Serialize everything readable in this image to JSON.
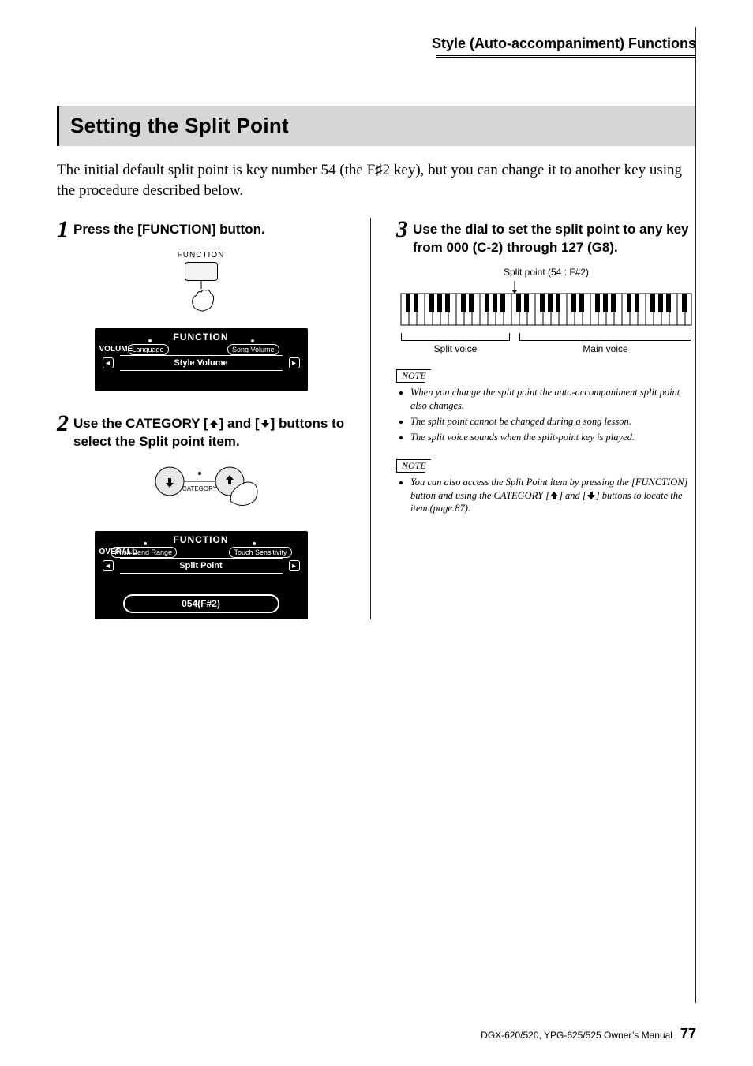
{
  "header": {
    "chapter": "Style (Auto-accompaniment) Functions"
  },
  "section_title": "Setting the Split Point",
  "intro_pre": "The initial default split point is key number 54 (the F",
  "intro_sharp": "♯",
  "intro_post": "2 key), but you can change it to another key using the procedure described below.",
  "steps": {
    "s1": {
      "num": "1",
      "text": "Press the [FUNCTION] button."
    },
    "s2": {
      "num": "2",
      "pre": "Use the CATEGORY [",
      "mid": "] and [",
      "post": "] buttons to select the Split point item."
    },
    "s3": {
      "num": "3",
      "text": "Use the dial to set the split point to any key from 000 (C-2) through 127 (G8)."
    }
  },
  "fig1": {
    "btn_label": "FUNCTION",
    "lcd_title": "FUNCTION",
    "lcd_tag": "VOLUME",
    "left_pill": "Language",
    "right_pill": "Song Volume",
    "center": "Style Volume",
    "arrow_l": "◂",
    "arrow_r": "▸"
  },
  "fig2": {
    "cat_label": "CATEGORY",
    "lcd_title": "FUNCTION",
    "lcd_tag": "OVERALL",
    "left_pill": "Pitch Bend Range",
    "right_pill": "Touch Sensitivity",
    "center": "Split Point",
    "value": "054(F#2)",
    "arrow_l": "◂",
    "arrow_r": "▸"
  },
  "kb": {
    "caption": "Split point (54 : F#2)",
    "split_label": "Split voice",
    "main_label": "Main voice"
  },
  "notes1": {
    "head": "NOTE",
    "items": [
      "When you change the split point the auto-accompaniment split point also changes.",
      "The split point cannot be changed during a song lesson.",
      "The split voice sounds when the split-point key is played."
    ]
  },
  "notes2": {
    "head": "NOTE",
    "item_pre": "You can also access the Split Point item by pressing the [FUNCTION] button and using the CATEGORY [",
    "item_mid": "] and [",
    "item_post": "] buttons to locate the item (page 87)."
  },
  "footer": {
    "manual": "DGX-620/520, YPG-625/525  Owner’s Manual",
    "page": "77"
  }
}
